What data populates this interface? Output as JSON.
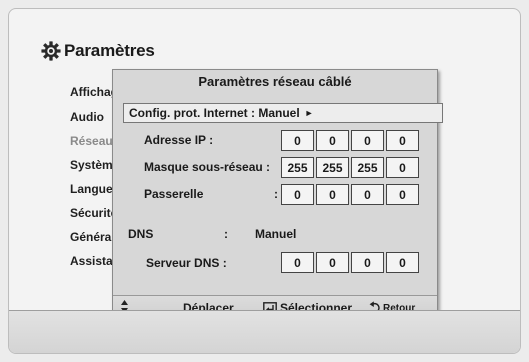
{
  "settings": {
    "title": "Paramètres",
    "gear_icon": "gear-icon"
  },
  "menu": {
    "items": [
      {
        "label": "Affichage",
        "active": true
      },
      {
        "label": "Audio",
        "active": true
      },
      {
        "label": "Réseau",
        "active": false
      },
      {
        "label": "Système",
        "active": true
      },
      {
        "label": "Langue",
        "active": true
      },
      {
        "label": "Sécurité",
        "active": true
      },
      {
        "label": "Général",
        "active": true
      },
      {
        "label": "Assistance",
        "active": true
      }
    ]
  },
  "dialog": {
    "title": "Paramètres réseau câblé",
    "protocol_label": "Config. prot. Internet : Manuel",
    "protocol_arrow": "►",
    "ip": {
      "label": "Adresse IP :",
      "octets": [
        "0",
        "0",
        "0",
        "0"
      ]
    },
    "subnet": {
      "label": "Masque sous-réseau :",
      "octets": [
        "255",
        "255",
        "255",
        "0"
      ]
    },
    "gateway": {
      "label": "Passerelle",
      "colon": ":",
      "octets": [
        "0",
        "0",
        "0",
        "0"
      ]
    },
    "dns": {
      "label": "DNS",
      "colon": ":",
      "mode": "Manuel"
    },
    "dns_server": {
      "label": "Serveur DNS :",
      "octets": [
        "0",
        "0",
        "0",
        "0"
      ]
    },
    "hints": {
      "move_icon": "up-down-arrow-icon",
      "move": "Déplacer",
      "select_icon": "enter-icon",
      "select": "Sélectionner",
      "back_icon": "return-icon",
      "back": "Retour"
    }
  }
}
